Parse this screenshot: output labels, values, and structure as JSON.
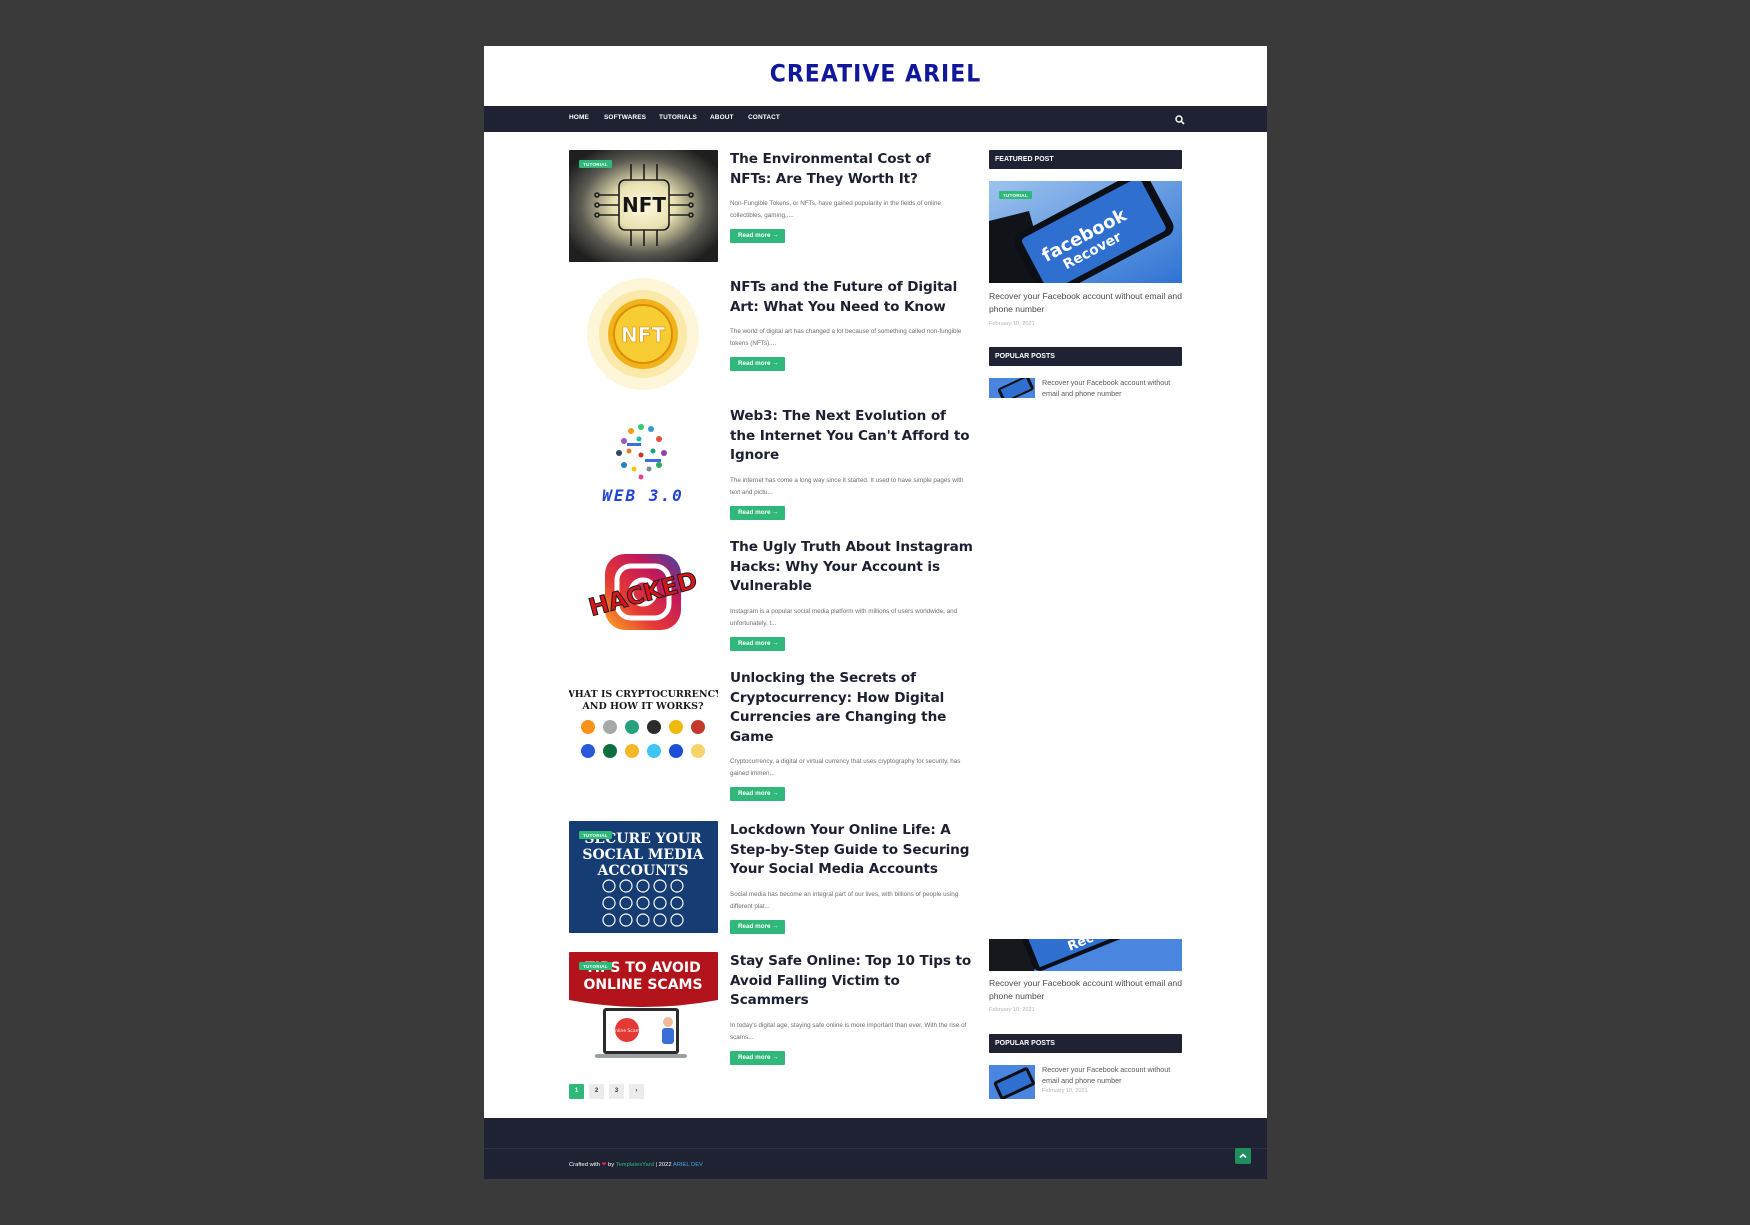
{
  "site": {
    "title": "CREATIVE ARIEL"
  },
  "nav": {
    "items": [
      {
        "label": "HOME"
      },
      {
        "label": "SOFTWARES"
      },
      {
        "label": "TUTORIALS"
      },
      {
        "label": "ABOUT"
      },
      {
        "label": "CONTACT"
      }
    ],
    "search_icon": "search-icon"
  },
  "posts": [
    {
      "tag": "TUTORIAL",
      "title": "The Environmental Cost of NFTs: Are They Worth It?",
      "excerpt": "Non-Fungible Tokens, or NFTs, have gained popularity in the fields of online collectibles, gaming,....",
      "read_more": "Read more →",
      "thumb_text": "NFT"
    },
    {
      "tag": "",
      "title": "NFTs and the Future of Digital Art: What You Need to Know",
      "excerpt": "The world of digital art has changed a lot because of something called non-fungible tokens (NFTs)....",
      "read_more": "Read more →",
      "thumb_text": "NFT"
    },
    {
      "tag": "",
      "title": "Web3: The Next Evolution of the Internet You Can't Afford to Ignore",
      "excerpt": "The internet has come a long way since it started. It used to have simple pages with text and pictu...",
      "read_more": "Read more →",
      "thumb_text": "WEB 3.0"
    },
    {
      "tag": "",
      "title": "The Ugly Truth About Instagram Hacks: Why Your Account is Vulnerable",
      "excerpt": "Instagram is a popular social media platform with millions of users worldwide, and unfortunately, t...",
      "read_more": "Read more →",
      "thumb_text": "HACKED"
    },
    {
      "tag": "",
      "title": "Unlocking the Secrets of Cryptocurrency: How Digital Currencies are Changing the Game",
      "excerpt": "Cryptocurrency, a digital or virtual currency that uses cryptography for security, has gained immen...",
      "read_more": "Read more →",
      "thumb_text_1": "WHAT IS CRYPTOCURRENCY",
      "thumb_text_2": "AND HOW IT WORKS?"
    },
    {
      "tag": "TUTORIAL",
      "title": "Lockdown Your Online Life: A Step-by-Step Guide to Securing Your Social Media Accounts",
      "excerpt": "Social media has become an integral part of our lives, with billions of people using different plat...",
      "read_more": "Read more →",
      "thumb_text_1": "SECURE YOUR",
      "thumb_text_2": "SOCIAL MEDIA",
      "thumb_text_3": "ACCOUNTS"
    },
    {
      "tag": "TUTORIAL",
      "title": "Stay Safe Online: Top 10 Tips to Avoid Falling Victim to Scammers",
      "excerpt": "In today's digital age, staying safe online is more important than ever. With the rise of scams...",
      "read_more": "Read more →",
      "thumb_text_1": "TIPS TO AVOID",
      "thumb_text_2": "ONLINE SCAMS",
      "thumb_text_3": "Online Scams"
    }
  ],
  "pagination": [
    "1",
    "2",
    "3",
    "›"
  ],
  "sidebar": {
    "featured": {
      "heading": "FEATURED POST",
      "tag": "TUTORIAL",
      "image_text_1": "facebook",
      "image_text_2": "Recover",
      "title": "Recover your Facebook account without email and phone number",
      "date": "February 10, 2021"
    },
    "popular": {
      "heading": "POPULAR POSTS",
      "items": [
        {
          "title": "Recover your Facebook account without email and phone number"
        }
      ]
    },
    "featured_repeat": {
      "image_text": "Rec",
      "title": "Recover your Facebook account without email and phone number",
      "date": "February 10, 2021"
    },
    "popular_repeat": {
      "heading": "POPULAR POSTS",
      "items": [
        {
          "title": "Recover your Facebook account without email and phone number",
          "date": "February 10, 2021"
        }
      ]
    }
  },
  "footer": {
    "crafted": "Crafted with",
    "heart": "❤",
    "by": "by",
    "brand": "TemplatesYard",
    "year": "| 2022",
    "dev": "ARIEL DEV"
  },
  "colors": {
    "accent": "#2fb879",
    "nav_bg": "#1e2232",
    "title": "#10179a",
    "page_bg": "#3a3a3a"
  }
}
